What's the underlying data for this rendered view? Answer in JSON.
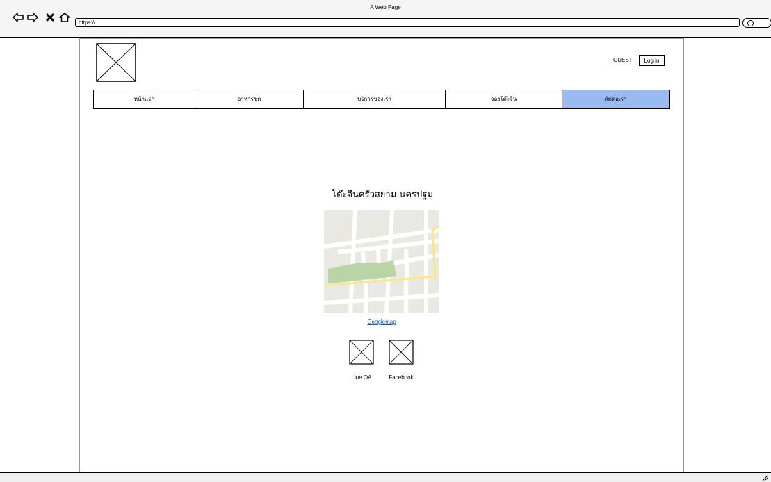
{
  "browser": {
    "title": "A Web Page",
    "url": "https://",
    "controls": [
      "back-icon",
      "forward-icon",
      "close-icon",
      "home-icon",
      "search-icon"
    ]
  },
  "header": {
    "logo_icon": "image-placeholder-icon",
    "guest_label": "_GUEST_",
    "login_label": "Log in"
  },
  "nav": {
    "items": [
      {
        "label": "หน้าแรก",
        "active": false
      },
      {
        "label": "อาหารชุด",
        "active": false
      },
      {
        "label": "บริการของเรา",
        "active": false
      },
      {
        "label": "จองโต๊ะจีน",
        "active": false
      },
      {
        "label": "ติดต่อเรา",
        "active": true
      }
    ],
    "active_color": "#99bbf2"
  },
  "contact": {
    "title": "โต๊ะจีนครัวสยาม นครปฐม",
    "map_icon": "map-icon",
    "map_link": "Googlemap",
    "social": [
      {
        "label": "Line OA",
        "icon": "image-placeholder-icon"
      },
      {
        "label": "Facebook",
        "icon": "image-placeholder-icon"
      }
    ]
  }
}
